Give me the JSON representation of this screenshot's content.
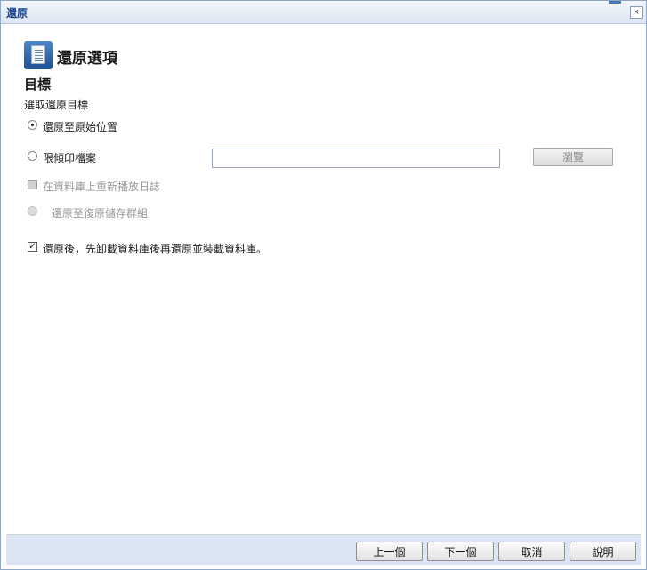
{
  "window": {
    "title": "還原",
    "close_glyph": "×"
  },
  "header": {
    "icon": "restore-options-icon",
    "title": "還原選項"
  },
  "section": {
    "title": "目標",
    "subtitle": "選取還原目標"
  },
  "options": {
    "restore_original": {
      "label": "還原至原始位置",
      "checked": true,
      "enabled": true
    },
    "dump_file": {
      "label": "限傾印檔案",
      "checked": false,
      "enabled": true,
      "value": "",
      "browse_label": "瀏覽",
      "browse_enabled": false
    },
    "replay_logs": {
      "label": "在資料庫上重新播放日誌",
      "checked": false,
      "enabled": false
    },
    "recovery_group": {
      "label": "還原至復原儲存群組",
      "checked": false,
      "enabled": false
    },
    "dismount": {
      "label": "還原後，先卸載資料庫後再還原並裝載資料庫。",
      "checked": true,
      "enabled": true
    }
  },
  "footer": {
    "prev": "上一個",
    "next": "下一個",
    "cancel": "取消",
    "help": "說明"
  },
  "colors": {
    "title_text": "#15428b",
    "footer_bg": "#dbe5f3",
    "icon_blue": "#2a5fa8"
  }
}
